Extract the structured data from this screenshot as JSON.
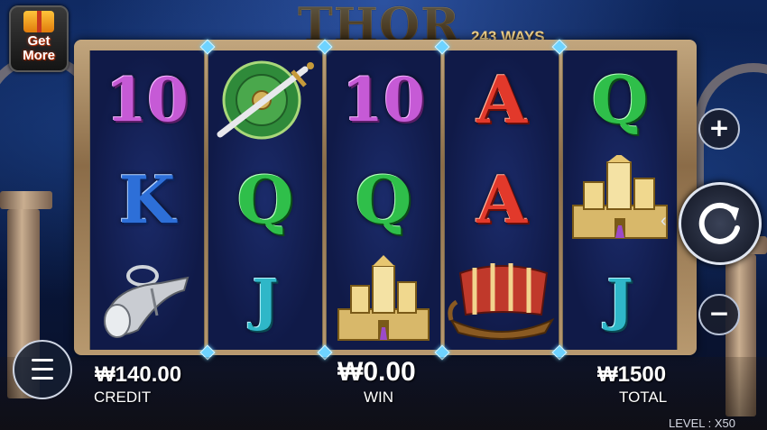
{
  "game": {
    "title": "THOR",
    "ways": "243 WAYS",
    "get_more": {
      "line1": "Get",
      "line2": "More"
    }
  },
  "reels": [
    [
      {
        "symbol": "10",
        "icon": "ten-symbol"
      },
      {
        "symbol": "K",
        "icon": "king-symbol"
      },
      {
        "symbol": "",
        "icon": "drinking-horn-symbol"
      }
    ],
    [
      {
        "symbol": "",
        "icon": "shield-sword-symbol"
      },
      {
        "symbol": "Q",
        "icon": "queen-symbol"
      },
      {
        "symbol": "J",
        "icon": "jack-symbol"
      }
    ],
    [
      {
        "symbol": "10",
        "icon": "ten-symbol"
      },
      {
        "symbol": "Q",
        "icon": "queen-symbol"
      },
      {
        "symbol": "",
        "icon": "asgard-palace-symbol"
      }
    ],
    [
      {
        "symbol": "A",
        "icon": "ace-symbol"
      },
      {
        "symbol": "A",
        "icon": "ace-symbol"
      },
      {
        "symbol": "",
        "icon": "viking-ship-symbol"
      }
    ],
    [
      {
        "symbol": "Q",
        "icon": "queen-symbol"
      },
      {
        "symbol": "",
        "icon": "asgard-palace-symbol"
      },
      {
        "symbol": "J",
        "icon": "jack-symbol"
      }
    ]
  ],
  "controls": {
    "plus": "+",
    "minus": "−",
    "spin_icon": "refresh-icon",
    "menu_icon": "hamburger-icon"
  },
  "info": {
    "credit_value": "₩140.00",
    "credit_label": "CREDIT",
    "win_value": "₩0.00",
    "win_label": "WIN",
    "total_value": "₩1500",
    "total_label": "TOTAL",
    "level": "LEVEL : X50"
  },
  "colors": {
    "background": "#0b1634",
    "frame_gold": "#b8996f",
    "reel_blue": "#15235c"
  }
}
